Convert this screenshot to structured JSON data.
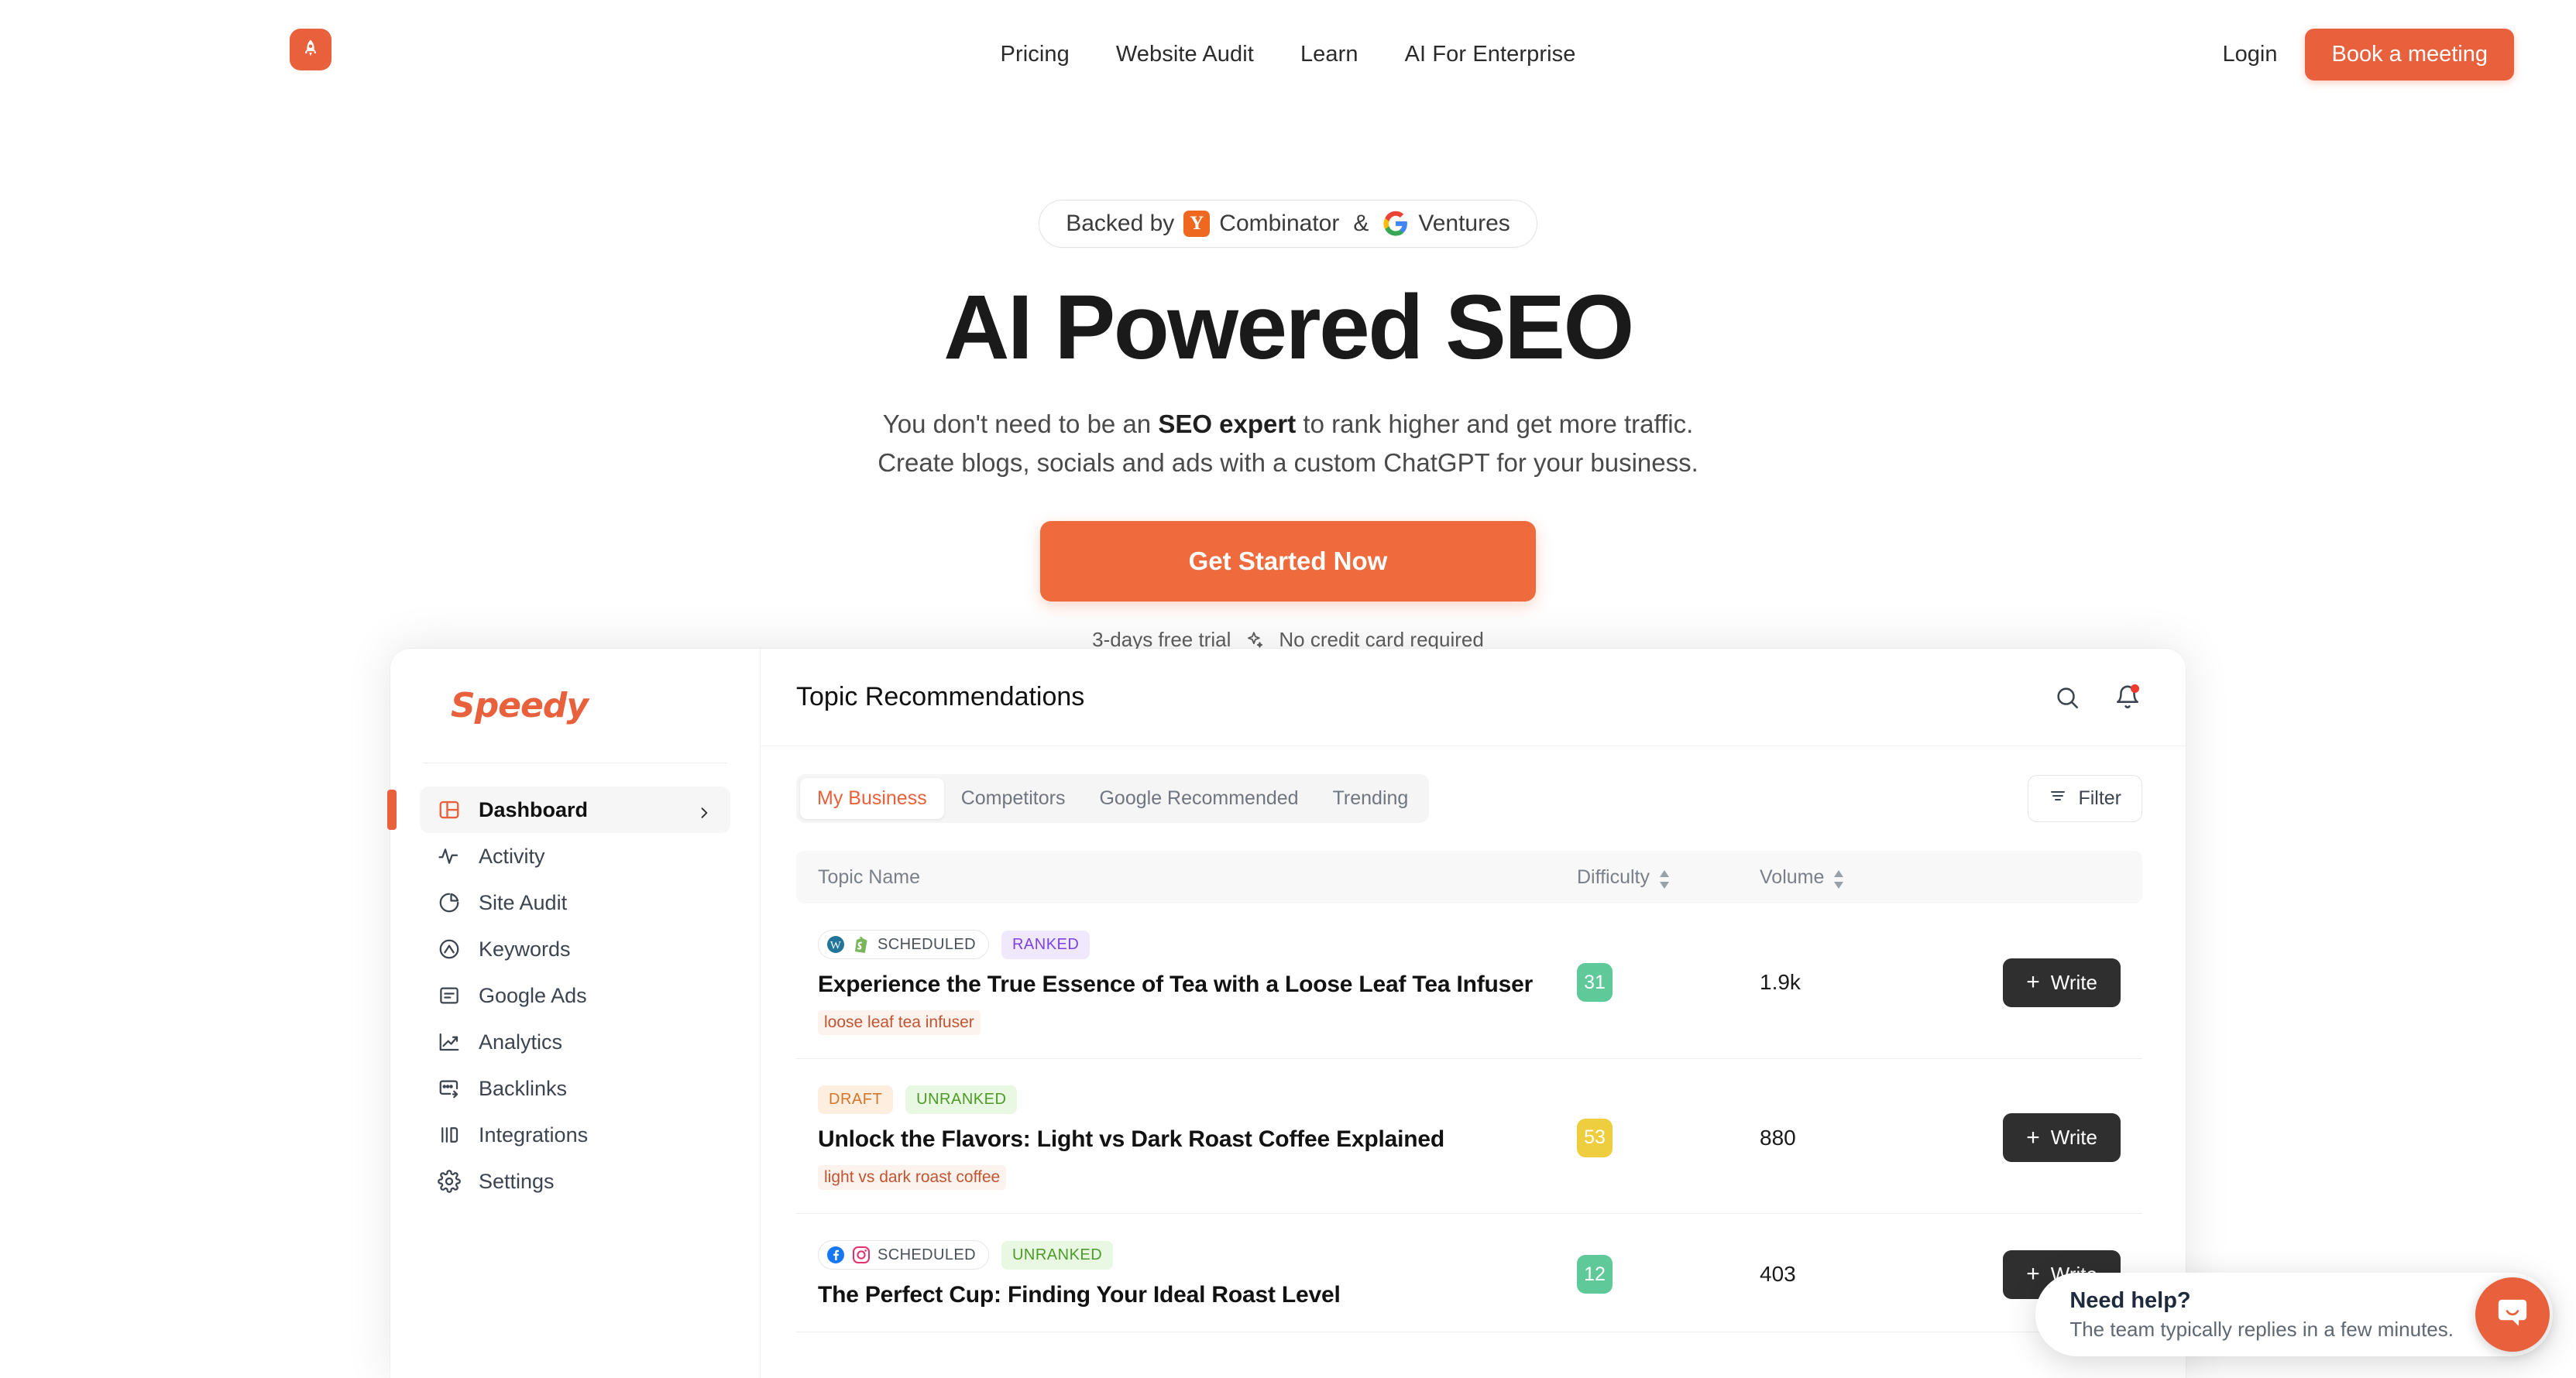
{
  "header": {
    "logo_icon": "rocket-icon",
    "nav_links": [
      "Pricing",
      "Website Audit",
      "Learn",
      "AI For Enterprise"
    ],
    "login_label": "Login",
    "meeting_label": "Book a meeting"
  },
  "hero": {
    "badge": {
      "prefix": "Backed by",
      "yc_mark": "Y",
      "yc_label": "Combinator",
      "amp": "&",
      "g_mark": "G",
      "g_label": "Ventures"
    },
    "title": "AI Powered SEO",
    "sub_line1_a": "You don't need to be an ",
    "sub_line1_b": "SEO expert",
    "sub_line1_c": " to rank higher and get more traffic.",
    "sub_line2": "Create blogs, socials and ads with a custom ChatGPT for your business.",
    "cta_label": "Get Started Now",
    "trial_left": "3-days free trial",
    "trial_icon": "sparkle-icon",
    "trial_right": "No credit card required"
  },
  "app": {
    "brand": "Speedy",
    "sidebar": [
      {
        "label": "Dashboard",
        "icon": "layout-dashboard-icon",
        "active": true,
        "chevron": true
      },
      {
        "label": "Activity",
        "icon": "activity-pulse-icon",
        "active": false,
        "chevron": false
      },
      {
        "label": "Site Audit",
        "icon": "pie-chart-icon",
        "active": false,
        "chevron": false
      },
      {
        "label": "Keywords",
        "icon": "keyword-circle-icon",
        "active": false,
        "chevron": false
      },
      {
        "label": "Google Ads",
        "icon": "document-lines-icon",
        "active": false,
        "chevron": false
      },
      {
        "label": "Analytics",
        "icon": "trending-up-icon",
        "active": false,
        "chevron": false
      },
      {
        "label": "Backlinks",
        "icon": "backlink-icon",
        "active": false,
        "chevron": false
      },
      {
        "label": "Integrations",
        "icon": "columns-icon",
        "active": false,
        "chevron": false
      },
      {
        "label": "Settings",
        "icon": "gear-icon",
        "active": false,
        "chevron": false
      }
    ],
    "main_title": "Topic Recommendations",
    "head_icons": [
      "search-icon",
      "bell-icon"
    ],
    "tabs": [
      {
        "label": "My Business",
        "active": true
      },
      {
        "label": "Competitors",
        "active": false
      },
      {
        "label": "Google Recommended",
        "active": false
      },
      {
        "label": "Trending",
        "active": false
      }
    ],
    "filter_label": "Filter",
    "columns": {
      "topic": "Topic Name",
      "difficulty": "Difficulty",
      "volume": "Volume"
    },
    "write_label": "Write",
    "rows": [
      {
        "platforms": [
          "wordpress-icon",
          "shopify-icon"
        ],
        "platform_status": "SCHEDULED",
        "rank_chip": "RANKED",
        "rank_chip_type": "ranked",
        "title": "Experience the True Essence of Tea with a Loose Leaf Tea Infuser",
        "keyword": "loose leaf tea infuser",
        "difficulty": "31",
        "difficulty_color": "#5fc99a",
        "volume": "1.9k"
      },
      {
        "platforms": [],
        "platform_status": "DRAFT",
        "rank_chip": "UNRANKED",
        "rank_chip_type": "unranked",
        "title": "Unlock the Flavors: Light vs Dark Roast Coffee Explained",
        "keyword": "light vs dark roast coffee",
        "difficulty": "53",
        "difficulty_color": "#eece3f",
        "volume": "880"
      },
      {
        "platforms": [
          "facebook-icon",
          "instagram-icon"
        ],
        "platform_status": "SCHEDULED",
        "rank_chip": "UNRANKED",
        "rank_chip_type": "unranked",
        "title": "The Perfect Cup: Finding Your Ideal Roast Level",
        "keyword": "",
        "difficulty": "12",
        "difficulty_color": "#5fc99a",
        "volume": "403"
      }
    ]
  },
  "chat": {
    "title": "Need help?",
    "subtitle": "The team typically replies in a few minutes.",
    "launcher_icon": "chat-bubble-icon"
  },
  "colors": {
    "brand_orange": "#e8603c",
    "cta_orange": "#ef6a3c",
    "dark_button": "#2f2f2f"
  }
}
